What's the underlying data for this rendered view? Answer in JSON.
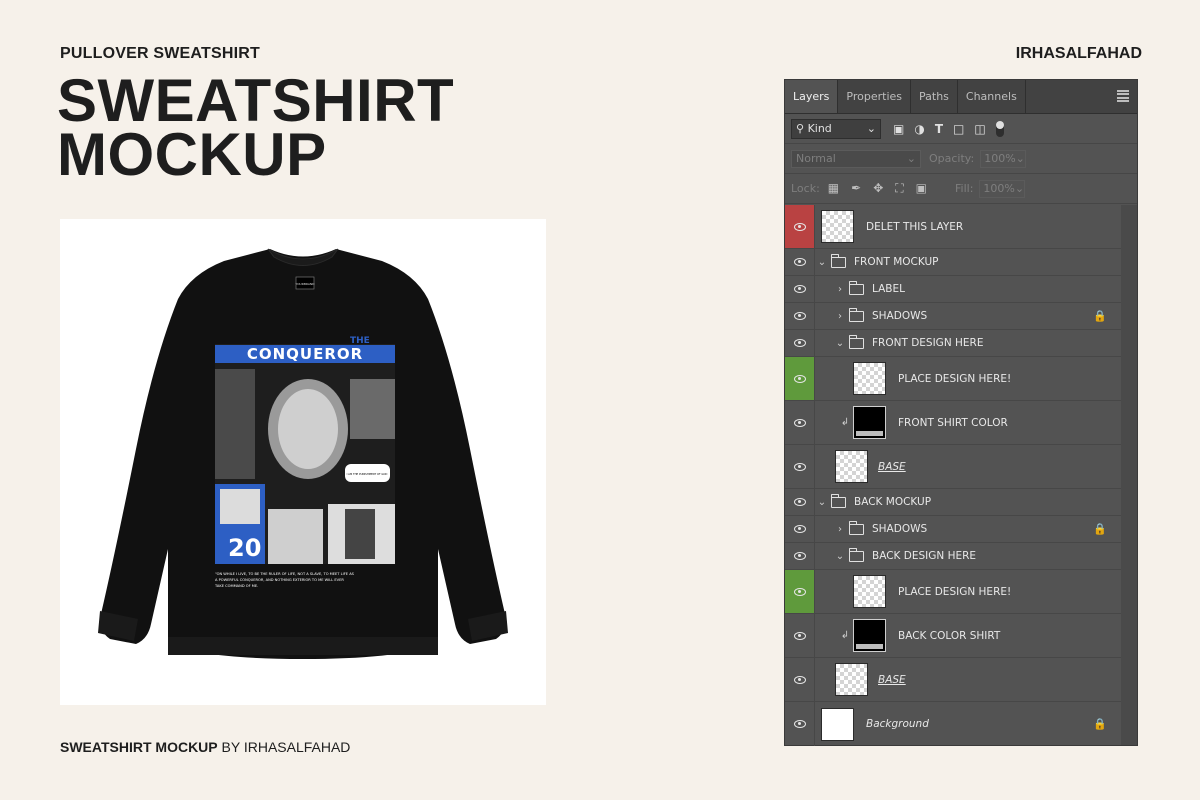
{
  "header": {
    "subtitle": "PULLOVER SWEATSHIRT",
    "brand": "IRHASALFAHAD",
    "title_line1": "SWEATSHIRT",
    "title_line2": "MOCKUP"
  },
  "caption": {
    "bold": "SWEATSHIRT MOCKUP",
    "rest": " BY IRHASALFAHAD"
  },
  "shirt_print": {
    "top_text": "THE",
    "logo_text": "CONQUEROR",
    "tag_text": "YOURBRAND",
    "bubble_text": "I AM THE PUNISHMENT OF GOD",
    "number": "20",
    "quote_line1": "\"ON WHILE I LIVE, TO BE THE RULER OF LIFE, NOT A SLAVE, TO MEET LIFE AS",
    "quote_line2": "A POWERFUL CONQUEROR, AND NOTHING EXTERIOR TO ME WILL EVER",
    "quote_line3": "TAKE            COMMAND            OF            ME."
  },
  "panel": {
    "tabs": [
      "Layers",
      "Properties",
      "Paths",
      "Channels"
    ],
    "kind_label": "Kind",
    "blend_mode": "Normal",
    "opacity_label": "Opacity:",
    "opacity_value": "100%",
    "lock_label": "Lock:",
    "fill_label": "Fill:",
    "fill_value": "100%",
    "layers": [
      {
        "name": "DELET THIS LAYER"
      },
      {
        "name": "FRONT MOCKUP"
      },
      {
        "name": "LABEL"
      },
      {
        "name": "SHADOWS"
      },
      {
        "name": "FRONT DESIGN HERE"
      },
      {
        "name": "PLACE DESIGN HERE!"
      },
      {
        "name": "FRONT SHIRT COLOR"
      },
      {
        "name": "BASE"
      },
      {
        "name": "BACK MOCKUP"
      },
      {
        "name": "SHADOWS"
      },
      {
        "name": "BACK DESIGN HERE"
      },
      {
        "name": "PLACE DESIGN HERE!"
      },
      {
        "name": "BACK COLOR SHIRT"
      },
      {
        "name": "BASE"
      },
      {
        "name": "Background"
      }
    ]
  },
  "colors": {
    "page_bg": "#f6f1ea",
    "panel_bg": "#535353",
    "red_layer": "#b94242",
    "green_layer": "#5f9a3c",
    "print_blue": "#2d5fc4"
  }
}
